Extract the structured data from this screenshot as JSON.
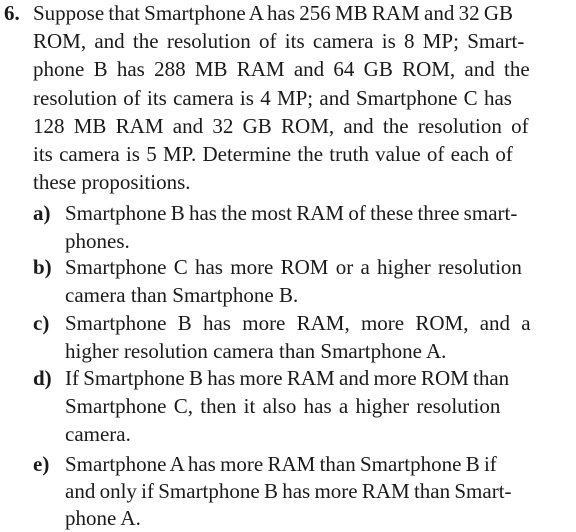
{
  "problem": {
    "number": "6.",
    "stem_lines": [
      "Suppose that Smartphone A has 256 MB RAM and 32 GB",
      "ROM, and the resolution of its camera is 8 MP; Smart-",
      "phone B has 288 MB RAM and 64 GB ROM, and the",
      "resolution of its camera is 4 MP; and Smartphone C has",
      "128 MB RAM and 32 GB ROM, and the resolution of",
      "its camera is 5 MP. Determine the truth value of each of",
      "these propositions."
    ],
    "parts": [
      {
        "label": "a)",
        "lines": [
          "Smartphone B has the most RAM of these three smart-",
          "phones."
        ]
      },
      {
        "label": "b)",
        "lines": [
          "Smartphone C has more ROM or a higher resolution",
          "camera than Smartphone B."
        ]
      },
      {
        "label": "c)",
        "lines": [
          "Smartphone B has more RAM, more ROM, and a",
          "higher resolution camera than Smartphone A."
        ]
      },
      {
        "label": "d)",
        "lines": [
          "If Smartphone B has more RAM and more ROM than",
          "Smartphone C, then it also has a higher resolution",
          "camera."
        ]
      },
      {
        "label": "e)",
        "lines": [
          "Smartphone A has more RAM than Smartphone B if",
          "and only if Smartphone B has more RAM than Smart-",
          "phone A."
        ]
      }
    ]
  }
}
